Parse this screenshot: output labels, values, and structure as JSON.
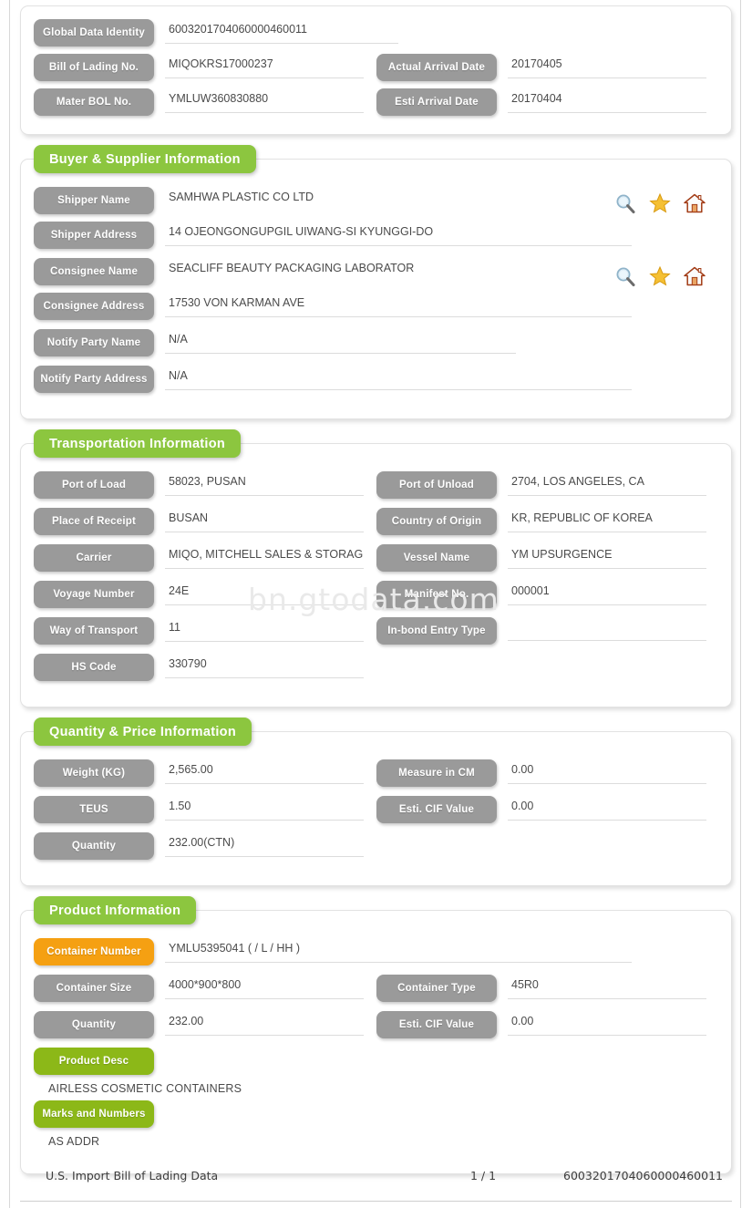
{
  "watermark": "bn.gtodata.com",
  "colors": {
    "section_green": "#8cc63f",
    "pill_gray": "#9a9a9a",
    "pill_orange": "#f5a012",
    "pill_green": "#8cb818"
  },
  "header_card": {
    "rows": [
      {
        "label": "Global Data Identity",
        "value": "6003201704060000460011"
      },
      {
        "label": "Bill of Lading No.",
        "value": "MIQOKRS17000237"
      },
      {
        "label": "Mater BOL No.",
        "value": "YMLUW360830880"
      }
    ],
    "right_rows": [
      {
        "label": "Actual Arrival Date",
        "value": "20170405"
      },
      {
        "label": "Esti Arrival Date",
        "value": "20170404"
      }
    ]
  },
  "buyer_supplier": {
    "title": "Buyer & Supplier Information",
    "rows": [
      {
        "label": "Shipper Name",
        "value": "SAMHWA PLASTIC CO LTD"
      },
      {
        "label": "Shipper Address",
        "value": "14 OJEONGONGUPGIL UIWANG-SI KYUNGGI-DO"
      },
      {
        "label": "Consignee Name",
        "value": "SEACLIFF BEAUTY PACKAGING LABORATOR"
      },
      {
        "label": "Consignee Address",
        "value": "17530 VON KARMAN AVE"
      },
      {
        "label": "Notify Party Name",
        "value": "N/A"
      },
      {
        "label": "Notify Party Address",
        "value": "N/A"
      }
    ],
    "icons": [
      {
        "name": "search-icon",
        "title": "Search"
      },
      {
        "name": "star-icon",
        "title": "Favorite"
      },
      {
        "name": "home-icon",
        "title": "Home"
      }
    ]
  },
  "transportation": {
    "title": "Transportation Information",
    "left_rows": [
      {
        "label": "Port of Load",
        "value": "58023, PUSAN"
      },
      {
        "label": "Place of Receipt",
        "value": "BUSAN"
      },
      {
        "label": "Carrier",
        "value": "MIQO, MITCHELL SALES & STORAGE I"
      },
      {
        "label": "Voyage Number",
        "value": "24E"
      },
      {
        "label": "Way of Transport",
        "value": "11"
      },
      {
        "label": "HS Code",
        "value": "330790"
      }
    ],
    "right_rows": [
      {
        "label": "Port of Unload",
        "value": "2704, LOS ANGELES, CA"
      },
      {
        "label": "Country of Origin",
        "value": "KR, REPUBLIC OF KOREA"
      },
      {
        "label": "Vessel Name",
        "value": "YM UPSURGENCE"
      },
      {
        "label": "Manifest No.",
        "value": "000001"
      },
      {
        "label": "In-bond Entry Type",
        "value": ""
      }
    ]
  },
  "quantity_price": {
    "title": "Quantity & Price Information",
    "left_rows": [
      {
        "label": "Weight (KG)",
        "value": "2,565.00"
      },
      {
        "label": "TEUS",
        "value": "1.50"
      },
      {
        "label": "Quantity",
        "value": "232.00(CTN)"
      }
    ],
    "right_rows": [
      {
        "label": "Measure in CM",
        "value": "0.00"
      },
      {
        "label": "Esti. CIF Value",
        "value": "0.00"
      }
    ]
  },
  "product": {
    "title": "Product Information",
    "container_number": {
      "label": "Container Number",
      "value": "YMLU5395041 ( / L / HH )"
    },
    "left_rows": [
      {
        "label": "Container Size",
        "value": "4000*900*800"
      },
      {
        "label": "Quantity",
        "value": "232.00"
      }
    ],
    "right_rows": [
      {
        "label": "Container Type",
        "value": "45R0"
      },
      {
        "label": "Esti. CIF Value",
        "value": "0.00"
      }
    ],
    "product_desc": {
      "label": "Product Desc",
      "text": "AIRLESS COSMETIC CONTAINERS"
    },
    "marks": {
      "label": "Marks and Numbers",
      "text": "AS ADDR"
    }
  },
  "footer": {
    "left": "U.S. Import Bill of Lading Data",
    "page": "1 / 1",
    "right": "6003201704060000460011"
  }
}
